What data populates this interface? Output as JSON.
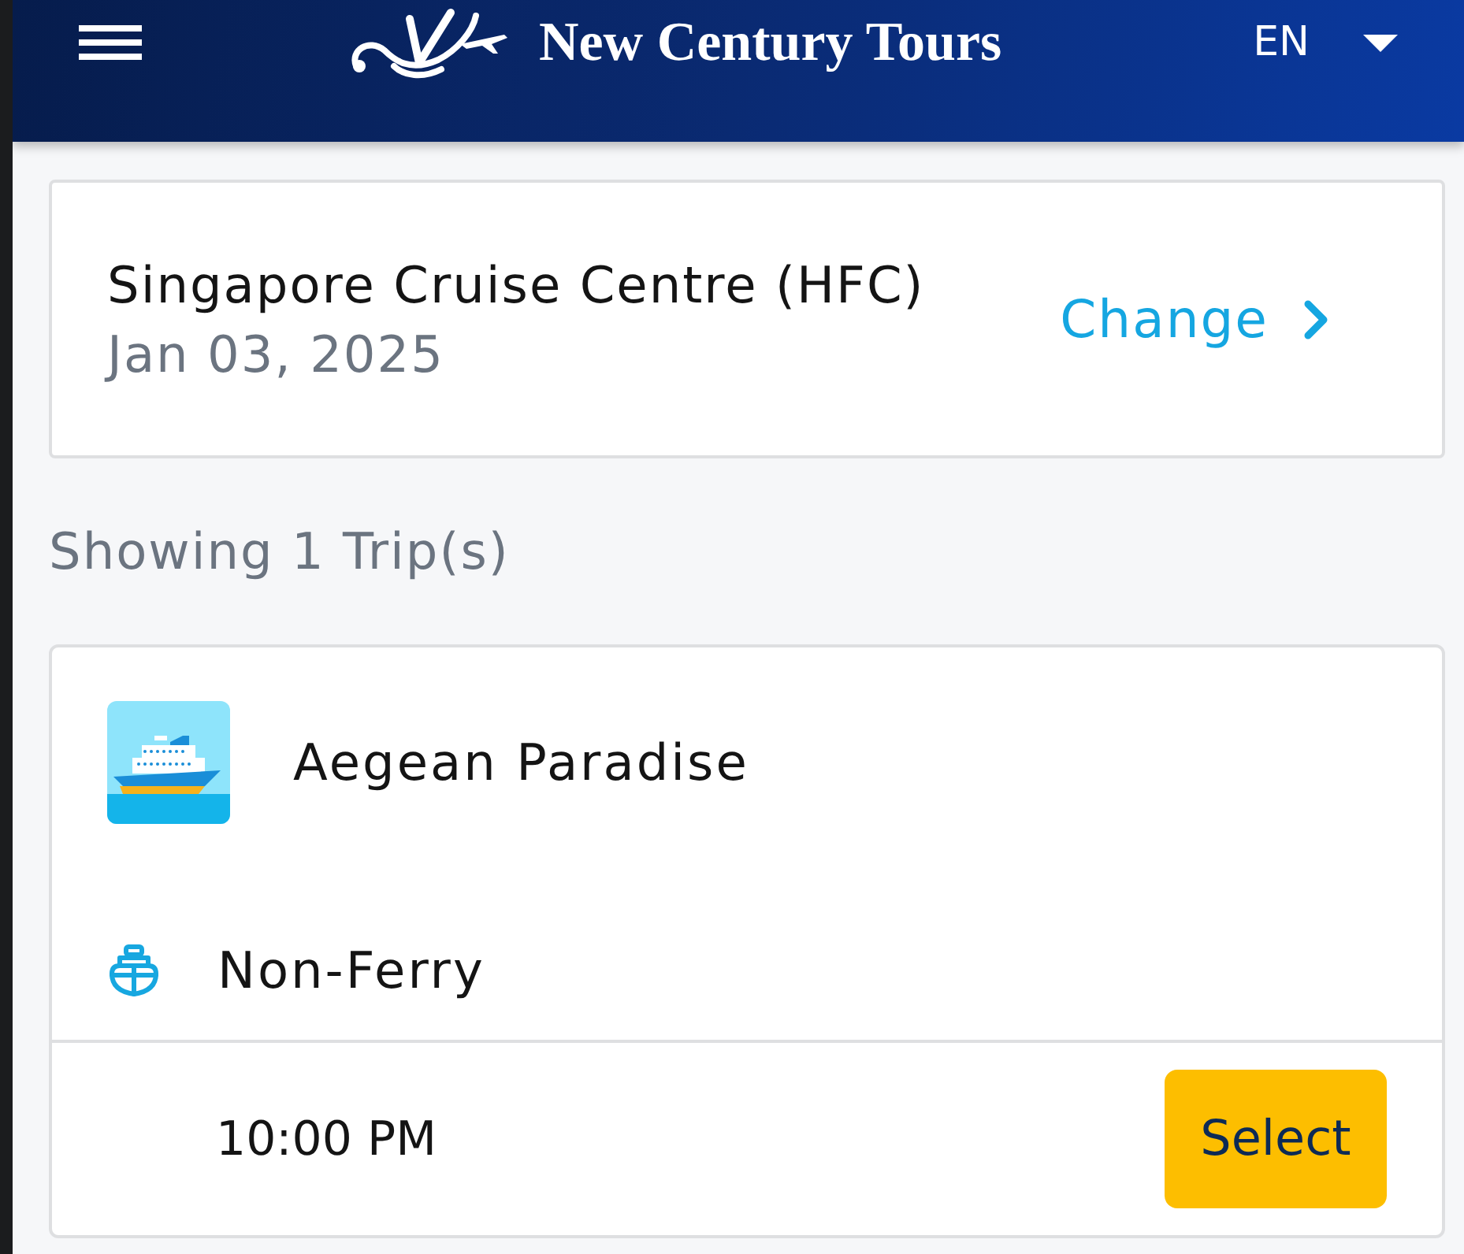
{
  "header": {
    "brand": "New Century Tours",
    "language": "EN"
  },
  "location": {
    "name": "Singapore Cruise Centre (HFC)",
    "date": "Jan 03, 2025",
    "action": "Change"
  },
  "results_summary": "Showing 1 Trip(s)",
  "trips": [
    {
      "vessel": "Aegean Paradise",
      "type": "Non-Ferry",
      "departures": [
        {
          "time": "10:00 PM",
          "action": "Select"
        }
      ]
    }
  ]
}
